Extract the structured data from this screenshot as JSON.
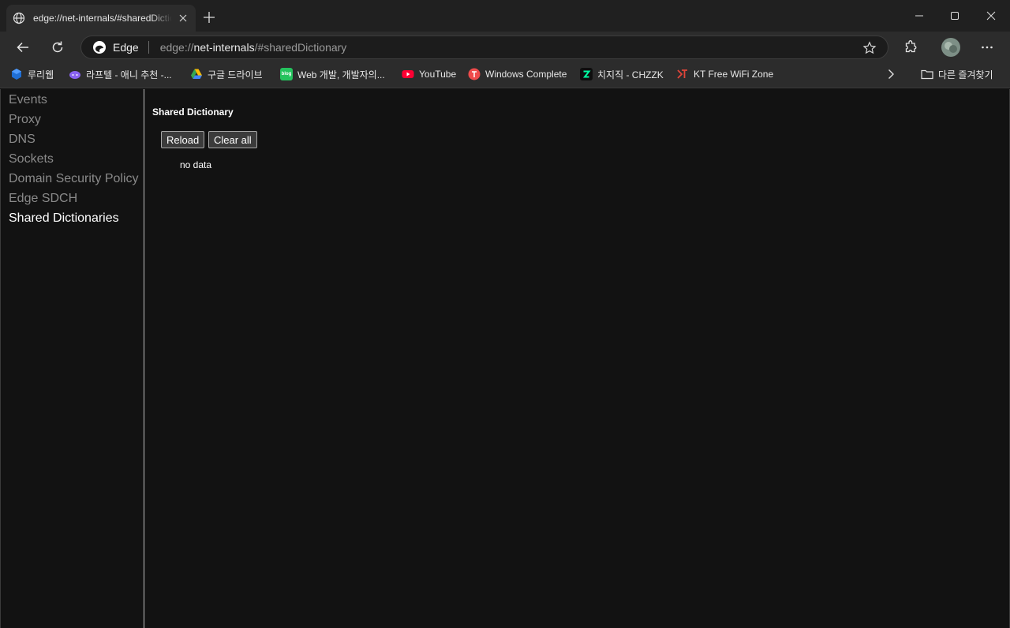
{
  "browser": {
    "tab": {
      "title": "edge://net-internals/#sharedDictionary"
    },
    "omnibox": {
      "site_label": "Edge",
      "url_prefix": "edge://",
      "url_host": "net-internals",
      "url_path": "/#sharedDictionary"
    },
    "bookmarks": [
      {
        "label": "루리웹",
        "icon": "ruliweb-icon",
        "color": "#1f6fd6"
      },
      {
        "label": "라프텔 - 애니 추천 -...",
        "icon": "laftel-icon",
        "color": "#8a63f0"
      },
      {
        "label": "구글 드라이브",
        "icon": "google-drive-icon",
        "color": "#34a853"
      },
      {
        "label": "Web 개발, 개발자의...",
        "icon": "blog-icon",
        "color": "#24c35d"
      },
      {
        "label": "YouTube",
        "icon": "youtube-icon",
        "color": "#ff0033"
      },
      {
        "label": "Windows Complete",
        "icon": "windows-complete-icon",
        "color": "#ef4b4b"
      },
      {
        "label": "치지직 - CHZZK",
        "icon": "chzzk-icon",
        "color": "#00ffa3"
      },
      {
        "label": "KT Free WiFi Zone",
        "icon": "kt-icon",
        "color": "#e0453a"
      }
    ],
    "other_favorites": "다른 즐겨찾기"
  },
  "sidebar": {
    "items": [
      {
        "label": "Events",
        "active": false
      },
      {
        "label": "Proxy",
        "active": false
      },
      {
        "label": "DNS",
        "active": false
      },
      {
        "label": "Sockets",
        "active": false
      },
      {
        "label": "Domain Security Policy",
        "active": false
      },
      {
        "label": "Edge SDCH",
        "active": false
      },
      {
        "label": "Shared Dictionaries",
        "active": true
      }
    ]
  },
  "main": {
    "title": "Shared Dictionary",
    "reload_label": "Reload",
    "clear_all_label": "Clear all",
    "status": "no data"
  }
}
